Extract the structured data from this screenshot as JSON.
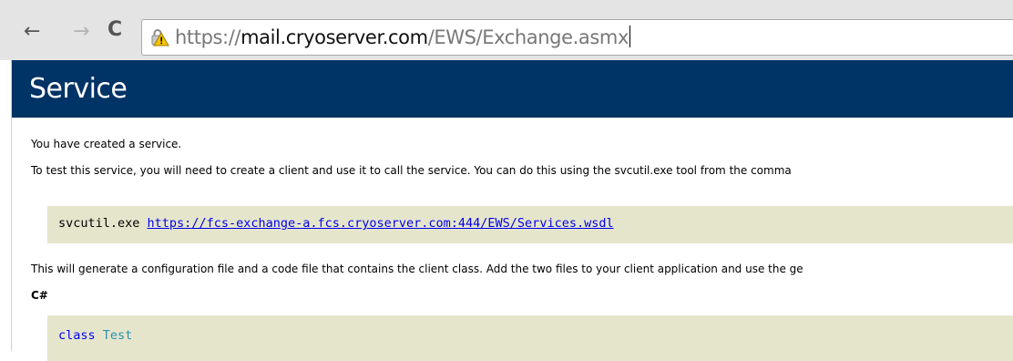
{
  "browser": {
    "back_icon": "←",
    "forward_icon": "→",
    "reload_icon": "C",
    "url": {
      "scheme": "https://",
      "host": "mail.cryoserver.com",
      "path": "/EWS/Exchange.asmx"
    }
  },
  "page": {
    "title": "Service",
    "intro": "You have created a service.",
    "test_instructions": "To test this service, you will need to create a client and use it to call the service. You can do this using the svcutil.exe tool from the comma",
    "command": {
      "tool": "svcutil.exe",
      "wsdl_url": "https://fcs-exchange-a.fcs.cryoserver.com:444/EWS/Services.wsdl"
    },
    "generate_text": "This will generate a configuration file and a code file that contains the client class. Add the two files to your client application and use the ge",
    "language_heading": "C#",
    "code": {
      "keyword": "class",
      "class_name": "Test"
    }
  }
}
